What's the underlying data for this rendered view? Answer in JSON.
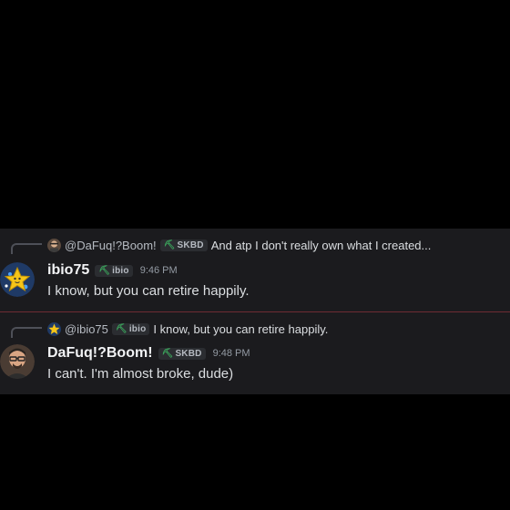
{
  "messages": [
    {
      "reply": {
        "author": "@DaFuq!?Boom!",
        "tag": "SKBD",
        "text": "And atp I don't really own what I created..."
      },
      "author": "ibio75",
      "tag": "ibio",
      "time": "9:46 PM",
      "content": "I know, but you can retire happily."
    },
    {
      "reply": {
        "author": "@ibio75",
        "tag": "ibio",
        "text": "I know, but you can retire happily."
      },
      "author": "DaFuq!?Boom!",
      "tag": "SKBD",
      "time": "9:48 PM",
      "content": "I can't. I'm almost broke, dude)"
    }
  ],
  "colors": {
    "background": "#000000",
    "chat_background": "#1b1b1e",
    "divider": "#6e2b34",
    "author": "#f2f3f5",
    "text": "#dbdee1",
    "timestamp": "#949ba4"
  },
  "icons": {
    "tag_icon": "pickaxe-icon",
    "avatar_ibio": "star-avatar",
    "avatar_dafuq": "man-with-glasses-avatar"
  }
}
